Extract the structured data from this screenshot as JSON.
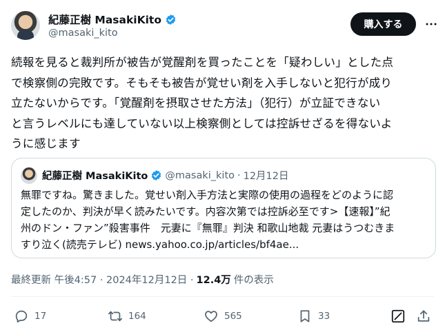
{
  "author": {
    "display_name": "紀藤正樹 MasakiKito",
    "handle": "@masaki_kito"
  },
  "buy_button_label": "購入する",
  "post_text": "続報を見ると裁判所が被告が覚醒剤を買ったことを「疑わしい」とした点\nで検察側の完敗です。そもそも被告が覚せい剤を入手しないと犯行が成り\n立たないからです。「覚醒剤を摂取させた方法」（犯行）が立証できない\nと言うレベルにも達していない以上検察側としては控訴せざるを得ないよ\nうに感じます",
  "quote": {
    "display_name": "紀藤正樹 MasakiKito",
    "handle": "@masaki_kito",
    "separator": "·",
    "date": "12月12日",
    "text": "無罪ですね。驚きました。覚せい剤入手方法と実際の使用の過程をどのように認\n定したのか、判決が早く読みたいです。内容次第では控訴必至です>【速報】”紀\n州のドン・ファン”殺害事件　元妻に『無罪』判決 和歌山地裁 元妻はうつむきま\nすり泣く(読売テレビ) news.yahoo.co.jp/articles/bf4ae..."
  },
  "meta": {
    "updated_label": "最終更新 午後4:57 · 2024年12月12日 ·",
    "views_count": "12.4万",
    "views_label": "件の表示"
  },
  "actions": {
    "reply_count": "17",
    "repost_count": "164",
    "like_count": "565",
    "bookmark_count": "33"
  },
  "colors": {
    "verified": "#1d9bf0",
    "text": "#0f1419",
    "secondary": "#536471",
    "border": "#cfd9de"
  }
}
